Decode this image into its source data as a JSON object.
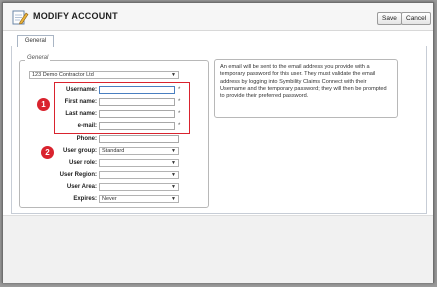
{
  "dialog": {
    "title": "MODIFY ACCOUNT",
    "title_icon": "edit-document-icon",
    "buttons": {
      "save": "Save",
      "cancel": "Cancel"
    }
  },
  "tabs": [
    {
      "label": "General",
      "active": true
    }
  ],
  "tab_accent_color": "#4a7fc0",
  "general": {
    "legend": "General",
    "company": "123 Demo Contractor Ltd",
    "fields": {
      "username": {
        "label": "Username:",
        "value": "",
        "required": "*"
      },
      "first_name": {
        "label": "First name:",
        "value": "",
        "required": "*"
      },
      "last_name": {
        "label": "Last name:",
        "value": "",
        "required": "*"
      },
      "email": {
        "label": "e-mail:",
        "value": "",
        "required": "*"
      },
      "phone": {
        "label": "Phone:",
        "value": ""
      },
      "user_group": {
        "label": "User group:",
        "value": "Standard"
      },
      "user_role": {
        "label": "User role:",
        "value": ""
      },
      "user_region": {
        "label": "User Region:",
        "value": ""
      },
      "user_area": {
        "label": "User Area:",
        "value": ""
      },
      "expires": {
        "label": "Expires:",
        "value": "Never"
      }
    }
  },
  "callouts": {
    "one": "1",
    "two": "2",
    "color": "#d9232e"
  },
  "info_text": "An email will be sent to the email address you provide with a temporary password for this user. They must validate the email address by logging into Symbility Claims Connect with their Username and the temporary password; they will then be prompted to provide their preferred password."
}
